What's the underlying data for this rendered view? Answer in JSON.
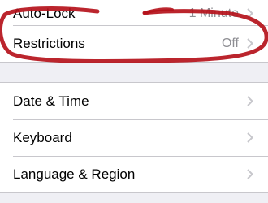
{
  "settings": {
    "top_group": [
      {
        "label": "Auto-Lock",
        "value": "1 Minute"
      },
      {
        "label": "Restrictions",
        "value": "Off"
      }
    ],
    "bottom_group": [
      {
        "label": "Date & Time"
      },
      {
        "label": "Keyboard"
      },
      {
        "label": "Language & Region"
      }
    ]
  },
  "icons": {
    "chevron": "chevron-right-icon"
  },
  "colors": {
    "background": "#efeff4",
    "cell": "#ffffff",
    "separator": "#c8c7cc",
    "value_text": "#8e8e93",
    "chevron": "#c7c7cc",
    "annotation": "#b5121b"
  }
}
